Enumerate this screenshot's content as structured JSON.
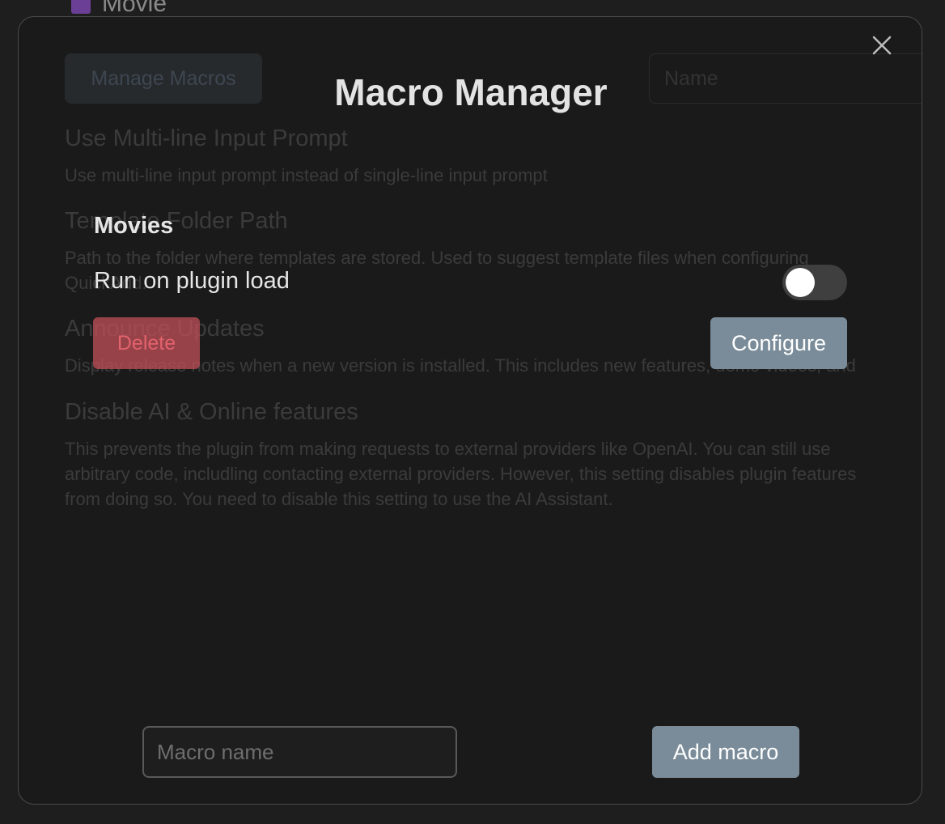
{
  "background": {
    "note_title": "Movie",
    "manage_macros_label": "Manage Macros",
    "name_placeholder": "Name",
    "settings": [
      {
        "title": "Use Multi-line Input Prompt",
        "desc": [
          "Use multi-line input prompt instead of single-line input prompt"
        ]
      },
      {
        "title": "Template Folder Path",
        "desc": [
          "Path to the folder where templates are stored. Used to suggest template files when configuring",
          "QuickAdd."
        ]
      },
      {
        "title": "Announce Updates",
        "desc": [
          "Display release notes when a new version is installed. This includes new features, demo videos, and"
        ]
      },
      {
        "title": "Disable AI & Online features",
        "desc": [
          "This prevents the plugin from making requests to external providers like OpenAI. You can still use",
          "arbitrary code, includling contacting external providers. However, this setting disables plugin features",
          "from doing so. You need to disable this setting to use the AI Assistant."
        ]
      }
    ]
  },
  "modal": {
    "title": "Macro Manager",
    "close_icon": "close-icon",
    "macro": {
      "name": "Movies",
      "run_on_load_label": "Run on plugin load",
      "run_on_load": false,
      "delete_label": "Delete",
      "configure_label": "Configure"
    },
    "footer": {
      "input_placeholder": "Macro name",
      "input_value": "",
      "add_label": "Add macro"
    }
  },
  "colors": {
    "accent_button": "#7a8c99",
    "delete_button": "#ba4e56"
  }
}
